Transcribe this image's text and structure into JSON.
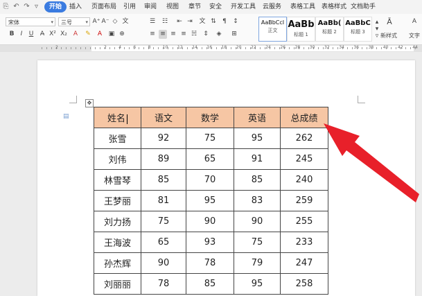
{
  "menubar": {
    "tabs": [
      {
        "label": "开始",
        "active": true
      },
      {
        "label": "插入"
      },
      {
        "label": "页面布局"
      },
      {
        "label": "引用"
      },
      {
        "label": "审阅"
      },
      {
        "label": "视图"
      },
      {
        "label": "章节"
      },
      {
        "label": "安全"
      },
      {
        "label": "开发工具"
      },
      {
        "label": "云服务"
      },
      {
        "label": "表格工具"
      },
      {
        "label": "表格样式"
      },
      {
        "label": "文档助手"
      }
    ]
  },
  "ribbon": {
    "font_name": "宋体",
    "font_size": "三号",
    "styles": [
      {
        "sample": "AaBbCcI",
        "name": "正文"
      },
      {
        "sample": "AaBb",
        "name": "标题 1"
      },
      {
        "sample": "AaBb(",
        "name": "标题 2"
      },
      {
        "sample": "AaBbC",
        "name": "标题 3"
      }
    ],
    "new_style_label": "新样式",
    "text_tool_label": "文字"
  },
  "ruler": {
    "numbers": [
      "2",
      "2",
      "4",
      "6",
      "8",
      "10",
      "12",
      "14",
      "16",
      "18",
      "20",
      "22",
      "24",
      "26",
      "28",
      "30",
      "32",
      "34",
      "36",
      "38",
      "40",
      "42",
      "44"
    ]
  },
  "table": {
    "headers": [
      "姓名",
      "语文",
      "数学",
      "英语",
      "总成绩"
    ],
    "rows": [
      [
        "张雪",
        "92",
        "75",
        "95",
        "262"
      ],
      [
        "刘伟",
        "89",
        "65",
        "91",
        "245"
      ],
      [
        "林雪琴",
        "85",
        "70",
        "85",
        "240"
      ],
      [
        "王梦丽",
        "81",
        "95",
        "83",
        "259"
      ],
      [
        "刘力扬",
        "75",
        "90",
        "90",
        "255"
      ],
      [
        "王海波",
        "65",
        "93",
        "75",
        "233"
      ],
      [
        "孙杰辉",
        "90",
        "78",
        "79",
        "247"
      ],
      [
        "刘丽丽",
        "78",
        "85",
        "95",
        "258"
      ]
    ]
  },
  "colors": {
    "header_fill": "#f6c6a4",
    "active_tab": "#3a7be0",
    "arrow": "#e8202a"
  }
}
